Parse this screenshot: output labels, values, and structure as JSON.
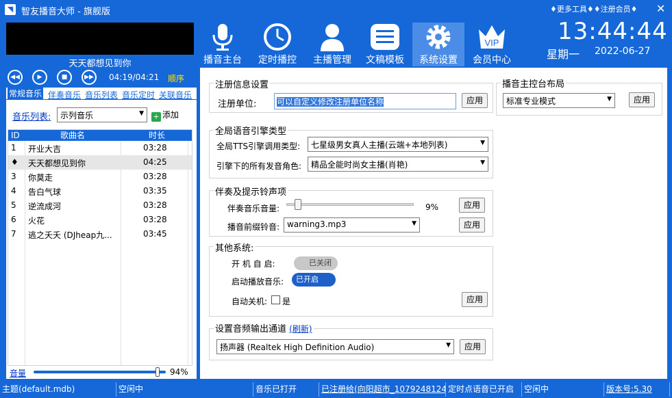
{
  "window": {
    "title": "智友播音大师 - 旗舰版",
    "more_tools": "♦更多工具♦",
    "register": "♦注册会员♦",
    "close_glyph": "✕"
  },
  "player": {
    "now_playing": "天天都想见到你",
    "time": "04:19/04:21",
    "order": "顺序"
  },
  "left_tabs": [
    "常规音乐",
    "伴奏音乐",
    "音乐列表",
    "音乐定时",
    "关联音乐"
  ],
  "music_list": {
    "label": "音乐列表:",
    "selected": "示列音乐",
    "add_label": "添加"
  },
  "table": {
    "headers": [
      "ID",
      "歌曲名",
      "时长"
    ],
    "rows": [
      {
        "id": "1",
        "name": "开业大吉",
        "duration": "03:28"
      },
      {
        "id": "♦",
        "name": "天天都想见到你",
        "duration": "04:25"
      },
      {
        "id": "3",
        "name": "你莫走",
        "duration": "03:28"
      },
      {
        "id": "4",
        "name": "告白气球",
        "duration": "03:35"
      },
      {
        "id": "5",
        "name": "逆流成河",
        "duration": "03:28"
      },
      {
        "id": "6",
        "name": "火花",
        "duration": "03:28"
      },
      {
        "id": "7",
        "name": "逃之夭夭 (DJheap九...",
        "duration": "03:45"
      }
    ]
  },
  "volume": {
    "label": "音量",
    "percent": "94%",
    "level": 0.94
  },
  "nav": [
    {
      "label": "播音主台",
      "icon": "microphone-icon"
    },
    {
      "label": "定时播控",
      "icon": "clock-icon"
    },
    {
      "label": "主播管理",
      "icon": "person-icon"
    },
    {
      "label": "文稿模板",
      "icon": "document-list-icon"
    },
    {
      "label": "系统设置",
      "icon": "gear-icon"
    },
    {
      "label": "会员中心",
      "icon": "vip-crown-icon",
      "badge": "VIP"
    }
  ],
  "clock": {
    "time": "13:44:44",
    "weekday": "星期一",
    "date": "2022-06-27"
  },
  "settings": {
    "registration": {
      "title": "注册信息设置",
      "unit_label": "注册单位:",
      "unit_value": "可以自定义修改注册单位名称",
      "apply": "应用"
    },
    "layout": {
      "title": "播音主控台布局",
      "value": "标准专业模式",
      "apply": "应用"
    },
    "engine": {
      "title": "全局语音引擎类型",
      "tts_label": "全局TTS引擎调用类型:",
      "tts_value": "七星级男女真人主播(云端+本地列表)",
      "voice_label": "引擎下的所有发音角色:",
      "voice_value": "精品全能时尚女主播(肖艳)"
    },
    "accompany": {
      "title": "伴奏及提示铃声项",
      "volume_label": "伴奏音乐音量:",
      "volume_pct": "9%",
      "volume_level": 0.09,
      "bell_label": "播音前缀铃音:",
      "bell_value": "warning3.mp3",
      "apply": "应用"
    },
    "other": {
      "title": "其他系统:",
      "autostart_label": "开 机 自 启:",
      "autostart_state": "已关闭",
      "autoplay_label": "启动播放音乐:",
      "autoplay_state": "已开启",
      "shutdown_label": "自动关机:",
      "shutdown_yes": "是",
      "apply": "应用"
    },
    "audio": {
      "title": "设置音频输出通道",
      "refresh": "(刷新)",
      "device": "扬声器 (Realtek High Definition Audio)",
      "apply": "应用"
    }
  },
  "status": [
    "主题(default.mdb)",
    "空闲中",
    "音乐已打开",
    "已注册给(向阳超市_1079248124",
    "定时点语音已开启",
    "空闲中",
    "版本号:5.30"
  ],
  "colors": {
    "accent": "#1668d8",
    "selection": "#3478db"
  }
}
